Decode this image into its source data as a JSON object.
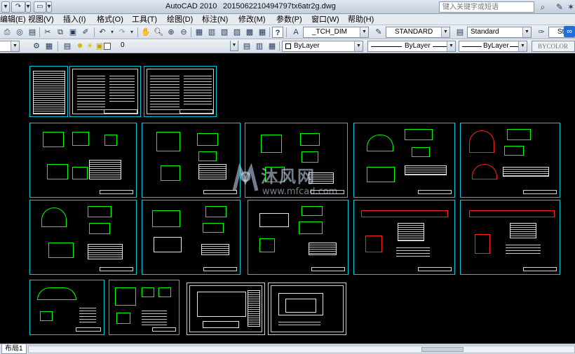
{
  "app": {
    "title": "AutoCAD 2010",
    "filename": "2015062210494797tx6atr2g.dwg"
  },
  "search": {
    "placeholder": "键入关键字或短语"
  },
  "menu": [
    {
      "id": "edit",
      "label": "编辑(E)"
    },
    {
      "id": "view",
      "label": "视图(V)"
    },
    {
      "id": "insert",
      "label": "插入(I)"
    },
    {
      "id": "format",
      "label": "格式(O)"
    },
    {
      "id": "tools",
      "label": "工具(T)"
    },
    {
      "id": "draw",
      "label": "绘图(D)"
    },
    {
      "id": "dimension",
      "label": "标注(N)"
    },
    {
      "id": "modify",
      "label": "修改(M)"
    },
    {
      "id": "parameters",
      "label": "参数(P)"
    },
    {
      "id": "window",
      "label": "窗口(W)"
    },
    {
      "id": "help",
      "label": "帮助(H)"
    }
  ],
  "toolbar1": {
    "dimstyle": "_TCH_DIM",
    "textstyle": "STANDARD",
    "tablestyle": "Standard",
    "mleaderstyle": "Stanc"
  },
  "toolbar2": {
    "layer": "0",
    "color": "ByLayer",
    "linetype": "ByLayer",
    "lineweight": "ByLayer",
    "plotstyle": "BYCOLOR"
  },
  "watermark": {
    "title": "沐风网",
    "url": "www.mfcad.com"
  },
  "layout_tab": {
    "label": "布局1"
  },
  "colors": {
    "canvas_bg": "#000000",
    "sheet_border": "#00c8d8",
    "drawing_green": "#00ff00",
    "drawing_red": "#ff2020",
    "drawing_white": "#e6e6e6"
  }
}
